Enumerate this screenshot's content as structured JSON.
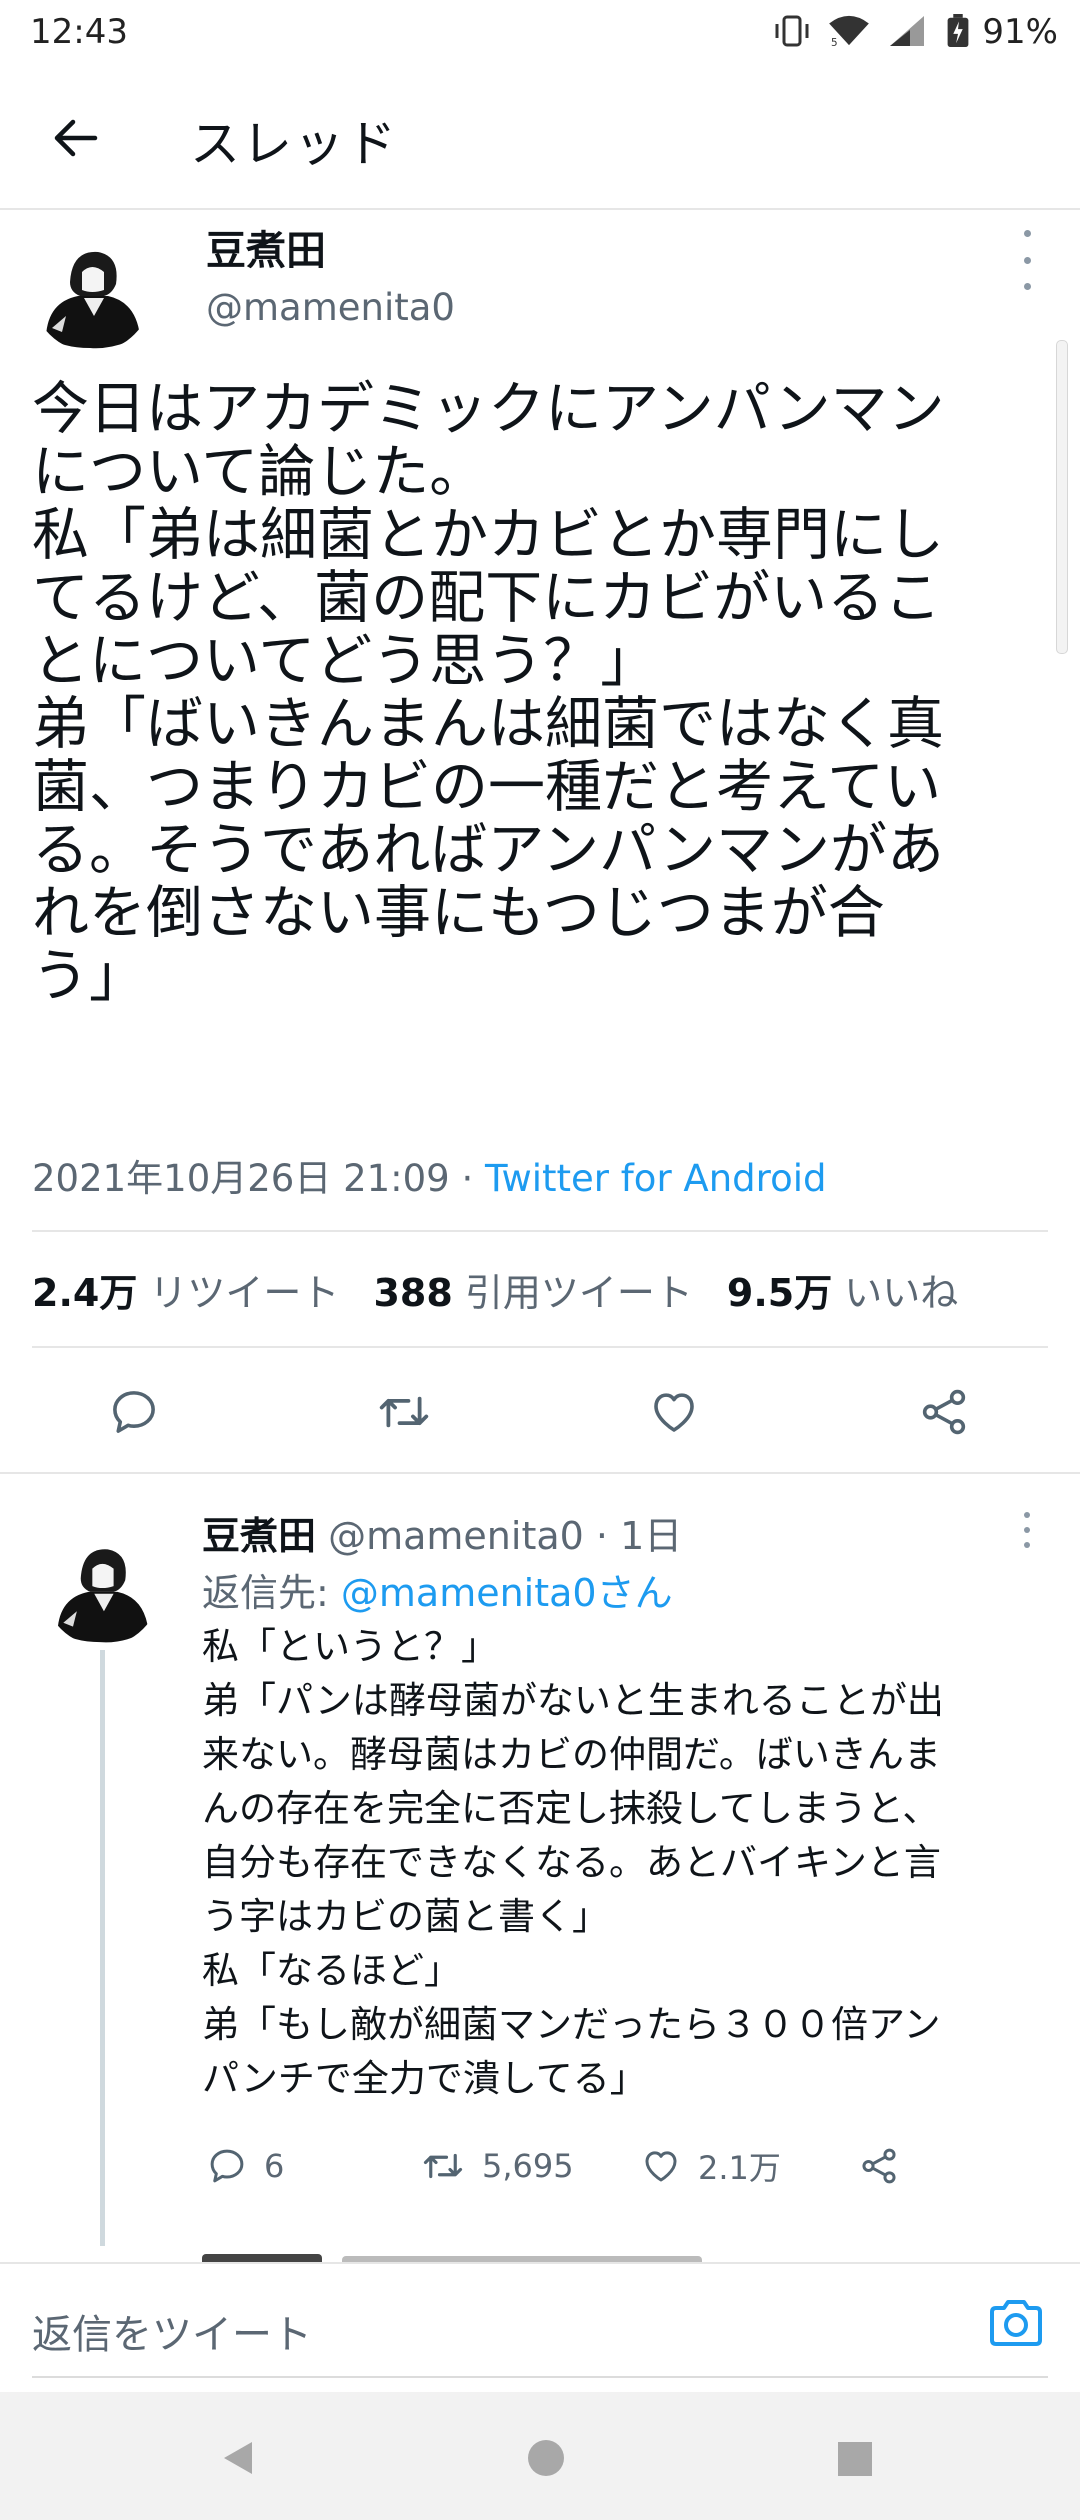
{
  "status_bar": {
    "time": "12:43",
    "battery": "91%",
    "icons": [
      "vibrate-icon",
      "wifi-icon",
      "signal-icon",
      "battery-charging-icon"
    ]
  },
  "header": {
    "title": "スレッド",
    "back_icon": "arrow-left-icon"
  },
  "main_tweet": {
    "author_name": "豆煮田",
    "handle": "@mamenita0",
    "text": "今日はアカデミックにアンパンマン\nについて論じた。\n私「弟は細菌とかカビとか専門にし\nてるけど、菌の配下にカビがいるこ\nとについてどう思う？」\n弟「ばいきんまんは細菌ではなく真\n菌、つまりカビの一種だと考えてい\nる。そうであればアンパンマンがあ\nれを倒さない事にもつじつまが合\nう」",
    "timestamp": "2021年10月26日 21:09",
    "separator": "·",
    "source": "Twitter for Android",
    "stats": {
      "retweets_count": "2.4万",
      "retweets_label": "リツイート",
      "quotes_count": "388",
      "quotes_label": "引用ツイート",
      "likes_count": "9.5万",
      "likes_label": "いいね"
    },
    "actions": [
      "reply-icon",
      "retweet-icon",
      "like-icon",
      "share-icon"
    ]
  },
  "reply_tweet": {
    "author_name": "豆煮田",
    "handle": "@mamenita0",
    "separator": "·",
    "time_ago": "1日",
    "reply_to_label": "返信先: ",
    "reply_to_mention": "@mamenita0さん",
    "text": "私「というと？」\n弟「パンは酵母菌がないと生まれることが出\n来ない。酵母菌はカビの仲間だ。ばいきんま\nんの存在を完全に否定し抹殺してしまうと、\n自分も存在できなくなる。あとバイキンと言\nう字はカビの菌と書く」\n私「なるほど」\n弟「もし敵が細菌マンだったら３００倍アン\nパンチで全力で潰してる」",
    "reply_count": "6",
    "retweet_count": "5,695",
    "like_count": "2.1万"
  },
  "composer": {
    "placeholder": "返信をツイート",
    "camera_icon": "camera-icon"
  },
  "nav_bar": {
    "icons": [
      "back-triangle-icon",
      "home-circle-icon",
      "recents-square-icon"
    ]
  },
  "colors": {
    "accent": "#1d9bf0",
    "text_primary": "#0f1419",
    "text_secondary": "#5b6773",
    "divider": "#e6e6e6"
  }
}
